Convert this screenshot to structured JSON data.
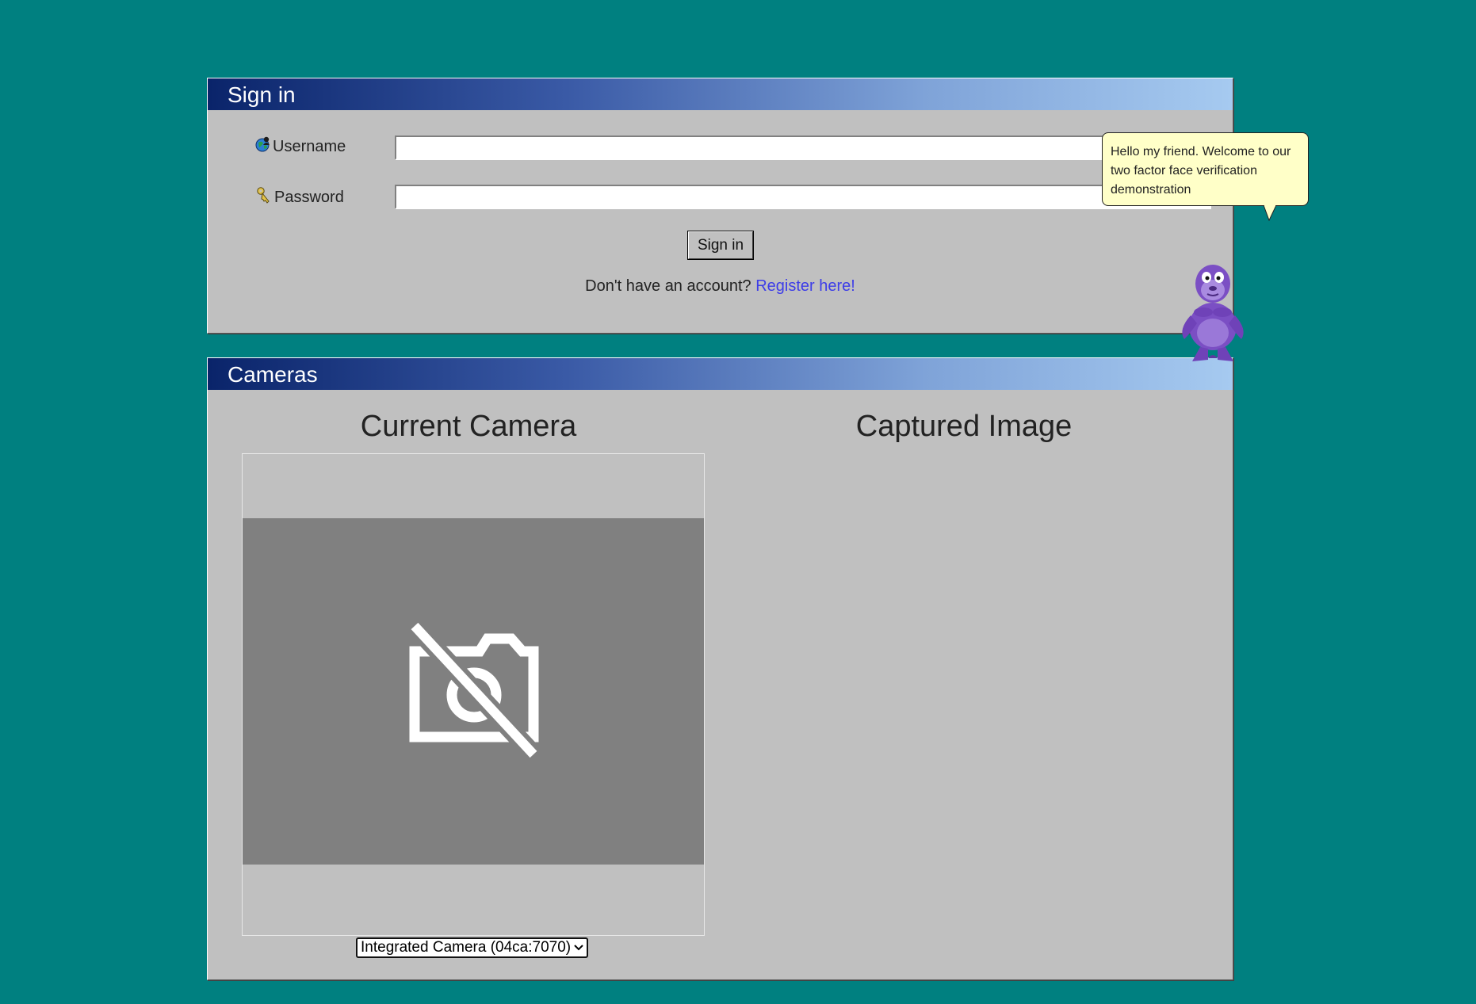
{
  "signin": {
    "title": "Sign in",
    "username_label": "Username",
    "username_value": "",
    "password_label": "Password",
    "password_value": "",
    "button_label": "Sign in",
    "register_prompt": "Don't have an account?",
    "register_link": "Register here!"
  },
  "cameras": {
    "title": "Cameras",
    "current_camera_title": "Current Camera",
    "captured_image_title": "Captured Image",
    "selected_camera": "Integrated Camera (04ca:7070)"
  },
  "assistant": {
    "message": "Hello my friend. Welcome to our two factor face verification demonstration"
  },
  "colors": {
    "desktop": "#008080",
    "window": "#c0c0c0",
    "titlebar_start": "#0a246a",
    "titlebar_end": "#a6caf0",
    "link": "#3d3de8",
    "tooltip": "#ffffc8"
  },
  "icons": [
    "globe-user-icon",
    "key-icon",
    "camera-off-icon",
    "chevron-down-icon",
    "purple-gorilla-assistant"
  ]
}
